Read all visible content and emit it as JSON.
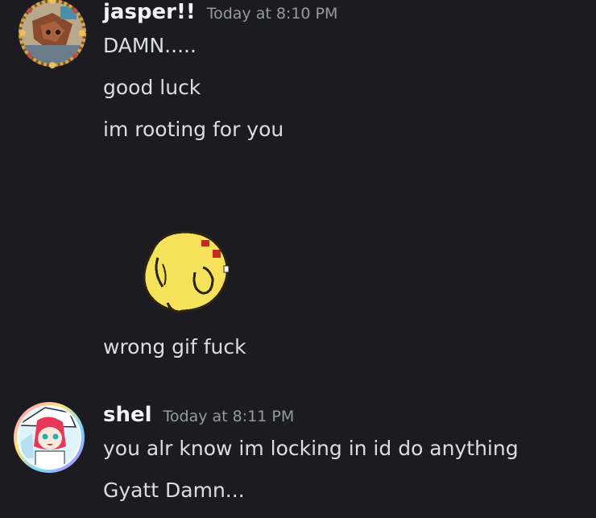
{
  "messages": [
    {
      "author": "jasper!!",
      "timestamp": "Today at 8:10 PM",
      "lines": [
        "DAMN.....",
        "good luck",
        "im rooting for you"
      ],
      "after_gif_lines": [
        "wrong gif fuck"
      ]
    },
    {
      "author": "shel",
      "timestamp": "Today at 8:11 PM",
      "lines": [
        "you alr know im locking in id do anything",
        "Gyatt Damn..."
      ]
    }
  ],
  "colors": {
    "background": "#1c1b22",
    "author_name": "#f2f3f5",
    "timestamp": "#949ba4",
    "message_text": "#dbdee1"
  },
  "icons": {
    "jasper_avatar": "ornate-gold-frame-avatar",
    "shel_avatar": "anime-girl-rainbow-ring-avatar",
    "gif": "yellow-pixel-blob-gif"
  }
}
